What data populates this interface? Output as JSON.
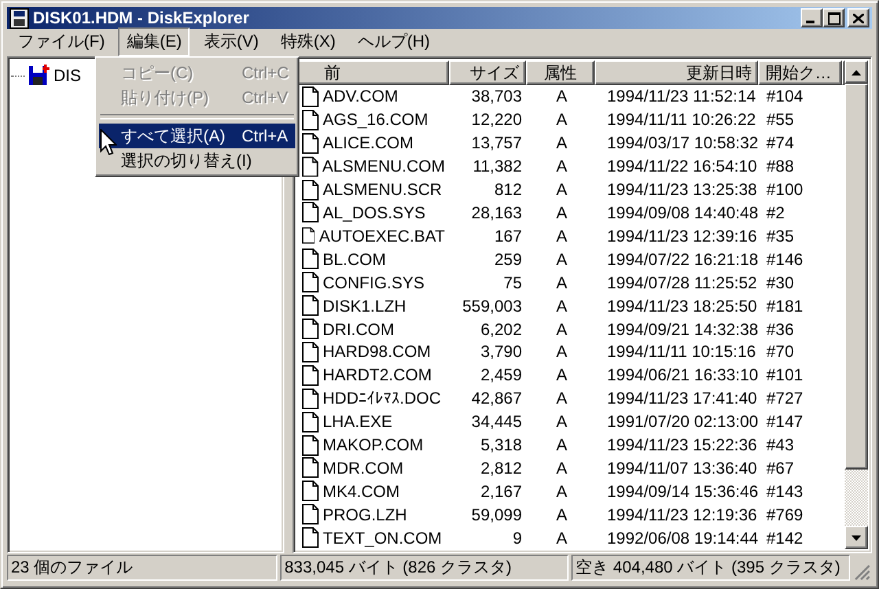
{
  "window": {
    "title": "DISK01.HDM - DiskExplorer"
  },
  "menu_bar": [
    {
      "label": "ファイル(F)",
      "selected": false
    },
    {
      "label": "編集(E)",
      "selected": true
    },
    {
      "label": "表示(V)",
      "selected": false
    },
    {
      "label": "特殊(X)",
      "selected": false
    },
    {
      "label": "ヘルプ(H)",
      "selected": false
    }
  ],
  "edit_menu": {
    "items": [
      {
        "kind": "item",
        "label": "コピー(C)",
        "shortcut": "Ctrl+C",
        "disabled": true,
        "selected": false
      },
      {
        "kind": "item",
        "label": "貼り付け(P)",
        "shortcut": "Ctrl+V",
        "disabled": true,
        "selected": false
      },
      {
        "kind": "separator"
      },
      {
        "kind": "item",
        "label": "すべて選択(A)",
        "shortcut": "Ctrl+A",
        "disabled": false,
        "selected": true
      },
      {
        "kind": "item",
        "label": "選択の切り替え(I)",
        "disabled": false,
        "selected": false
      }
    ]
  },
  "tree": {
    "items": [
      {
        "label": "DIS"
      }
    ]
  },
  "file_list": {
    "columns": [
      "前",
      "サイズ",
      "属性",
      "更新日時",
      "開始ク…"
    ],
    "rows": [
      {
        "name": "ADV.COM",
        "size": "38,703",
        "attr": "A",
        "modified": "1994/11/23 11:52:14",
        "start": "#104"
      },
      {
        "name": "AGS_16.COM",
        "size": "12,220",
        "attr": "A",
        "modified": "1994/11/11 10:26:22",
        "start": "#55"
      },
      {
        "name": "ALICE.COM",
        "size": "13,757",
        "attr": "A",
        "modified": "1994/03/17 10:58:32",
        "start": "#74"
      },
      {
        "name": "ALSMENU.COM",
        "size": "11,382",
        "attr": "A",
        "modified": "1994/11/22 16:54:10",
        "start": "#88"
      },
      {
        "name": "ALSMENU.SCR",
        "size": "812",
        "attr": "A",
        "modified": "1994/11/23 13:25:38",
        "start": "#100"
      },
      {
        "name": "AL_DOS.SYS",
        "size": "28,163",
        "attr": "A",
        "modified": "1994/09/08 14:40:48",
        "start": "#2"
      },
      {
        "name": "AUTOEXEC.BAT",
        "size": "167",
        "attr": "A",
        "modified": "1994/11/23 12:39:16",
        "start": "#35"
      },
      {
        "name": "BL.COM",
        "size": "259",
        "attr": "A",
        "modified": "1994/07/22 16:21:18",
        "start": "#146"
      },
      {
        "name": "CONFIG.SYS",
        "size": "75",
        "attr": "A",
        "modified": "1994/07/28 11:25:52",
        "start": "#30"
      },
      {
        "name": "DISK1.LZH",
        "size": "559,003",
        "attr": "A",
        "modified": "1994/11/23 18:25:50",
        "start": "#181"
      },
      {
        "name": "DRI.COM",
        "size": "6,202",
        "attr": "A",
        "modified": "1994/09/21 14:32:38",
        "start": "#36"
      },
      {
        "name": "HARD98.COM",
        "size": "3,790",
        "attr": "A",
        "modified": "1994/11/11 10:15:16",
        "start": "#70"
      },
      {
        "name": "HARDT2.COM",
        "size": "2,459",
        "attr": "A",
        "modified": "1994/06/21 16:33:10",
        "start": "#101"
      },
      {
        "name": "HDDﾆｲﾚﾏｽ.DOC",
        "size": "42,867",
        "attr": "A",
        "modified": "1994/11/23 17:41:40",
        "start": "#727"
      },
      {
        "name": "LHA.EXE",
        "size": "34,445",
        "attr": "A",
        "modified": "1991/07/20 02:13:00",
        "start": "#147"
      },
      {
        "name": "MAKOP.COM",
        "size": "5,318",
        "attr": "A",
        "modified": "1994/11/23 15:22:36",
        "start": "#43"
      },
      {
        "name": "MDR.COM",
        "size": "2,812",
        "attr": "A",
        "modified": "1994/11/07 13:36:40",
        "start": "#67"
      },
      {
        "name": "MK4.COM",
        "size": "2,167",
        "attr": "A",
        "modified": "1994/09/14 15:36:46",
        "start": "#143"
      },
      {
        "name": "PROG.LZH",
        "size": "59,099",
        "attr": "A",
        "modified": "1994/11/23 12:19:36",
        "start": "#769"
      },
      {
        "name": "TEXT_ON.COM",
        "size": "9",
        "attr": "A",
        "modified": "1992/06/08 19:14:44",
        "start": "#142"
      }
    ]
  },
  "status_bar": [
    "23 個のファイル",
    "833,045 バイト (826 クラスタ)",
    "空き 404,480 バイト (395 クラスタ)"
  ]
}
